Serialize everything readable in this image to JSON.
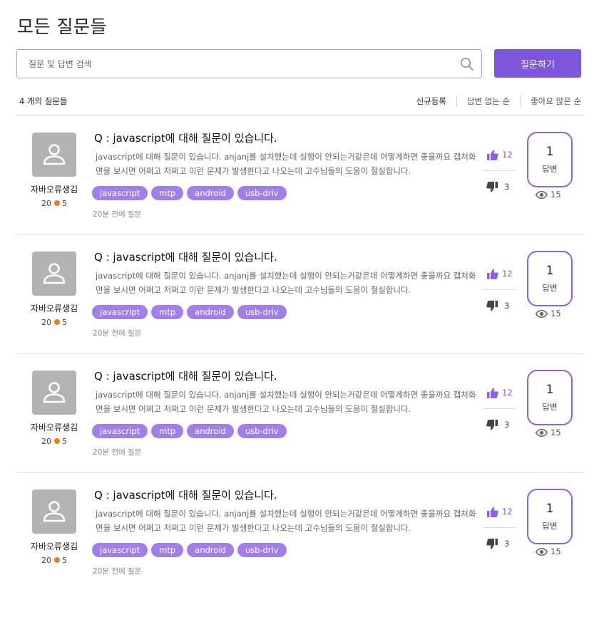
{
  "page": {
    "title": "모든 질문들"
  },
  "search": {
    "placeholder": "질문 및 답변 검색",
    "value": ""
  },
  "ask_button": {
    "label": "질문하기"
  },
  "list_header": {
    "count_label": "4 개의 질문들",
    "sort_tabs": [
      {
        "label": "신규등록",
        "active": true
      },
      {
        "label": "답변 없는 순",
        "active": false
      },
      {
        "label": "좋아요 많은 순",
        "active": false
      }
    ]
  },
  "colors": {
    "accent": "#7d56db",
    "tag": "#a07fe8",
    "point_dot": "#f07b1a"
  },
  "questions": [
    {
      "author": {
        "name": "자바오류생김",
        "score": "20",
        "points": "5",
        "avatar_icon": "user-icon"
      },
      "title": "Q : javascript에 대해 질문이 있습니다.",
      "body": "javascript에 대해 질문이 있습니다. anjanj를 설치했는데 실행이 안되는거같은데 어떻게하면 좋을까요 캡처화면을 보시면 어쩌고 저쩌고 이런 문제가 발생한다고 나오는데 고수님들의 도움이 절실합니다.",
      "tags": [
        "javascript",
        "mtp",
        "android",
        "usb-driv"
      ],
      "time": "20분 전에 질문",
      "likes": "12",
      "dislikes": "3",
      "answers": "1",
      "answer_label": "답변",
      "views": "15"
    },
    {
      "author": {
        "name": "자바오류생김",
        "score": "20",
        "points": "5",
        "avatar_icon": "user-icon"
      },
      "title": "Q : javascript에 대해 질문이 있습니다.",
      "body": "javascript에 대해 질문이 있습니다. anjanj를 설치했는데 실행이 안되는거같은데 어떻게하면 좋을까요 캡처화면을 보시면 어쩌고 저쩌고 이런 문제가 발생한다고 나오는데 고수님들의 도움이 절실합니다.",
      "tags": [
        "javascript",
        "mtp",
        "android",
        "usb-driv"
      ],
      "time": "20분 전에 질문",
      "likes": "12",
      "dislikes": "3",
      "answers": "1",
      "answer_label": "답변",
      "views": "15"
    },
    {
      "author": {
        "name": "자바오류생김",
        "score": "20",
        "points": "5",
        "avatar_icon": "user-icon"
      },
      "title": "Q : javascript에 대해 질문이 있습니다.",
      "body": "javascript에 대해 질문이 있습니다. anjanj를 설치했는데 실행이 안되는거같은데 어떻게하면 좋을까요 캡처화면을 보시면 어쩌고 저쩌고 이런 문제가 발생한다고 나오는데 고수님들의 도움이 절실합니다.",
      "tags": [
        "javascript",
        "mtp",
        "android",
        "usb-driv"
      ],
      "time": "20분 전에 질문",
      "likes": "12",
      "dislikes": "3",
      "answers": "1",
      "answer_label": "답변",
      "views": "15"
    },
    {
      "author": {
        "name": "자바오류생김",
        "score": "20",
        "points": "5",
        "avatar_icon": "user-icon"
      },
      "title": "Q : javascript에 대해 질문이 있습니다.",
      "body": "javascript에 대해 질문이 있습니다. anjanj를 설치했는데 실행이 안되는거같은데 어떻게하면 좋을까요 캡처화면을 보시면 어쩌고 저쩌고 이런 문제가 발생한다고 나오는데 고수님들의 도움이 절실합니다.",
      "tags": [
        "javascript",
        "mtp",
        "android",
        "usb-driv"
      ],
      "time": "20분 전에 질문",
      "likes": "12",
      "dislikes": "3",
      "answers": "1",
      "answer_label": "답변",
      "views": "15"
    }
  ]
}
